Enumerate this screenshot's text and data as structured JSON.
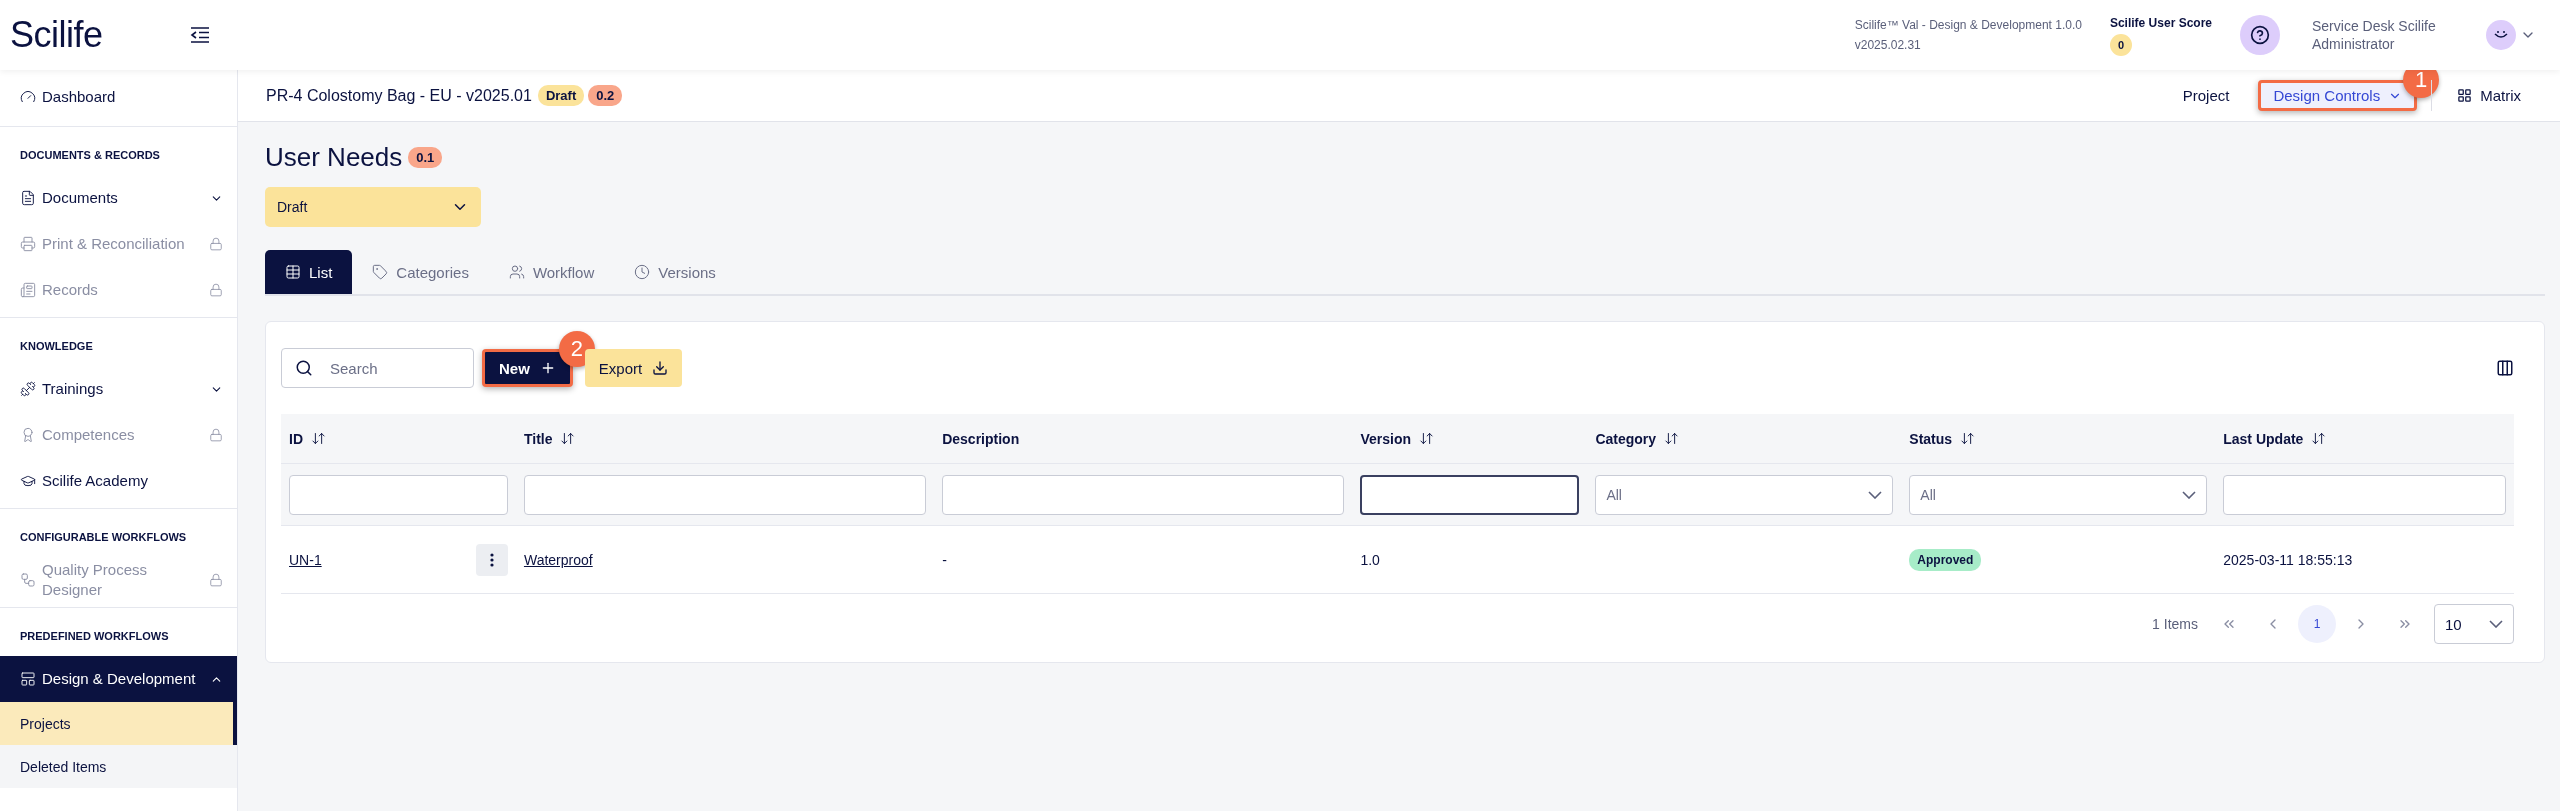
{
  "app": {
    "logo": "Scilife"
  },
  "header": {
    "product": "Scilife™ Val - Design & Development 1.0.0",
    "build": "v2025.02.31",
    "score_label": "Scilife User Score",
    "score": "0",
    "user_name": "Service Desk Scilife Administrator"
  },
  "sidebar": {
    "sections": [
      {
        "items": [
          {
            "label": "Dashboard",
            "locked": false,
            "selected": false
          }
        ]
      },
      {
        "title": "DOCUMENTS & RECORDS",
        "items": [
          {
            "label": "Documents",
            "locked": false,
            "selected": false,
            "expanded": false
          },
          {
            "label": "Print & Reconciliation",
            "locked": true,
            "selected": false
          },
          {
            "label": "Records",
            "locked": true,
            "selected": false
          }
        ]
      },
      {
        "title": "KNOWLEDGE",
        "items": [
          {
            "label": "Trainings",
            "locked": false,
            "selected": false,
            "expanded": false
          },
          {
            "label": "Competences",
            "locked": true,
            "selected": false
          },
          {
            "label": "Scilife Academy",
            "locked": false,
            "selected": false
          }
        ]
      },
      {
        "title": "CONFIGURABLE WORKFLOWS",
        "items": [
          {
            "label": "Quality Process Designer",
            "locked": true,
            "selected": false
          }
        ]
      },
      {
        "title": "PREDEFINED WORKFLOWS",
        "items": [
          {
            "label": "Design & Development",
            "locked": false,
            "selected": true,
            "expanded": true,
            "children": [
              {
                "label": "Projects",
                "selected": true
              },
              {
                "label": "Deleted Items",
                "selected": false
              }
            ]
          }
        ]
      }
    ]
  },
  "project_bar": {
    "title": "PR-4 Colostomy Bag - EU - v2025.01",
    "status": "Draft",
    "version": "0.2",
    "nav": [
      {
        "label": "Project",
        "kind": "link",
        "selected": false
      },
      {
        "label": "Design Controls",
        "kind": "dropdown",
        "selected": true,
        "callout": "1"
      },
      {
        "label": "Matrix",
        "kind": "grid",
        "selected": false
      }
    ]
  },
  "page": {
    "title": "User Needs",
    "version": "0.1",
    "state_select": "Draft"
  },
  "tabs": [
    {
      "label": "List",
      "selected": true
    },
    {
      "label": "Categories",
      "selected": false
    },
    {
      "label": "Workflow",
      "selected": false
    },
    {
      "label": "Versions",
      "selected": false
    }
  ],
  "toolbar": {
    "search_placeholder": "Search",
    "buttons": [
      {
        "label": "New",
        "kind": "primary",
        "callout": "2"
      },
      {
        "label": "Export",
        "kind": "secondary"
      }
    ]
  },
  "table": {
    "columns": [
      {
        "label": "ID",
        "sortable": true,
        "filter": {
          "kind": "text",
          "focused": false
        }
      },
      {
        "label": "Title",
        "sortable": true,
        "filter": {
          "kind": "text",
          "focused": false
        }
      },
      {
        "label": "Description",
        "sortable": false,
        "filter": {
          "kind": "text",
          "focused": false
        }
      },
      {
        "label": "Version",
        "sortable": true,
        "filter": {
          "kind": "text",
          "focused": true
        }
      },
      {
        "label": "Category",
        "sortable": true,
        "filter": {
          "kind": "select",
          "value": "All"
        }
      },
      {
        "label": "Status",
        "sortable": true,
        "filter": {
          "kind": "select",
          "value": "All"
        }
      },
      {
        "label": "Last Update",
        "sortable": true,
        "filter": {
          "kind": "text",
          "focused": false
        }
      }
    ],
    "rows": [
      {
        "id": "UN-1",
        "title": "Waterproof",
        "description": "-",
        "version": "1.0",
        "status": "Approved",
        "color": "#a7ecc8",
        "last_update": "2025-03-11 18:55:13"
      }
    ]
  },
  "pagination": {
    "count": "1 Items",
    "pages": [
      {
        "label": "1",
        "selected": true
      }
    ],
    "page_size": "10"
  }
}
